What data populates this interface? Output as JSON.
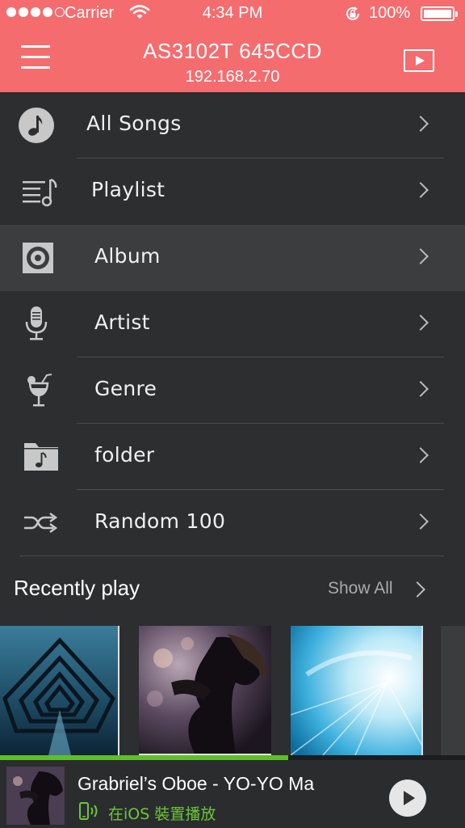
{
  "status_bar": {
    "carrier": "Carrier",
    "time": "4:34 PM",
    "battery": "100%"
  },
  "header": {
    "title": "AS3102T 645CCD",
    "subtitle": "192.168.2.70"
  },
  "menu": [
    {
      "label": "All Songs",
      "icon": "music-note-icon"
    },
    {
      "label": "Playlist",
      "icon": "playlist-icon"
    },
    {
      "label": "Album",
      "icon": "disc-icon",
      "selected": true
    },
    {
      "label": "Artist",
      "icon": "microphone-icon"
    },
    {
      "label": "Genre",
      "icon": "cocktail-icon"
    },
    {
      "label": "folder",
      "icon": "music-folder-icon"
    },
    {
      "label": "Random 100",
      "icon": "shuffle-icon"
    }
  ],
  "recent": {
    "title": "Recently  play",
    "show_all": "Show All"
  },
  "now_playing": {
    "title": "Grabriel’s Oboe - YO-YO Ma",
    "device": "在iOS 裝置播放",
    "progress": 0.62
  },
  "colors": {
    "header": "#f56c6f",
    "background": "#2c2e30",
    "selected_row": "#3b3d3f",
    "accent_green": "#5fbf2b"
  }
}
